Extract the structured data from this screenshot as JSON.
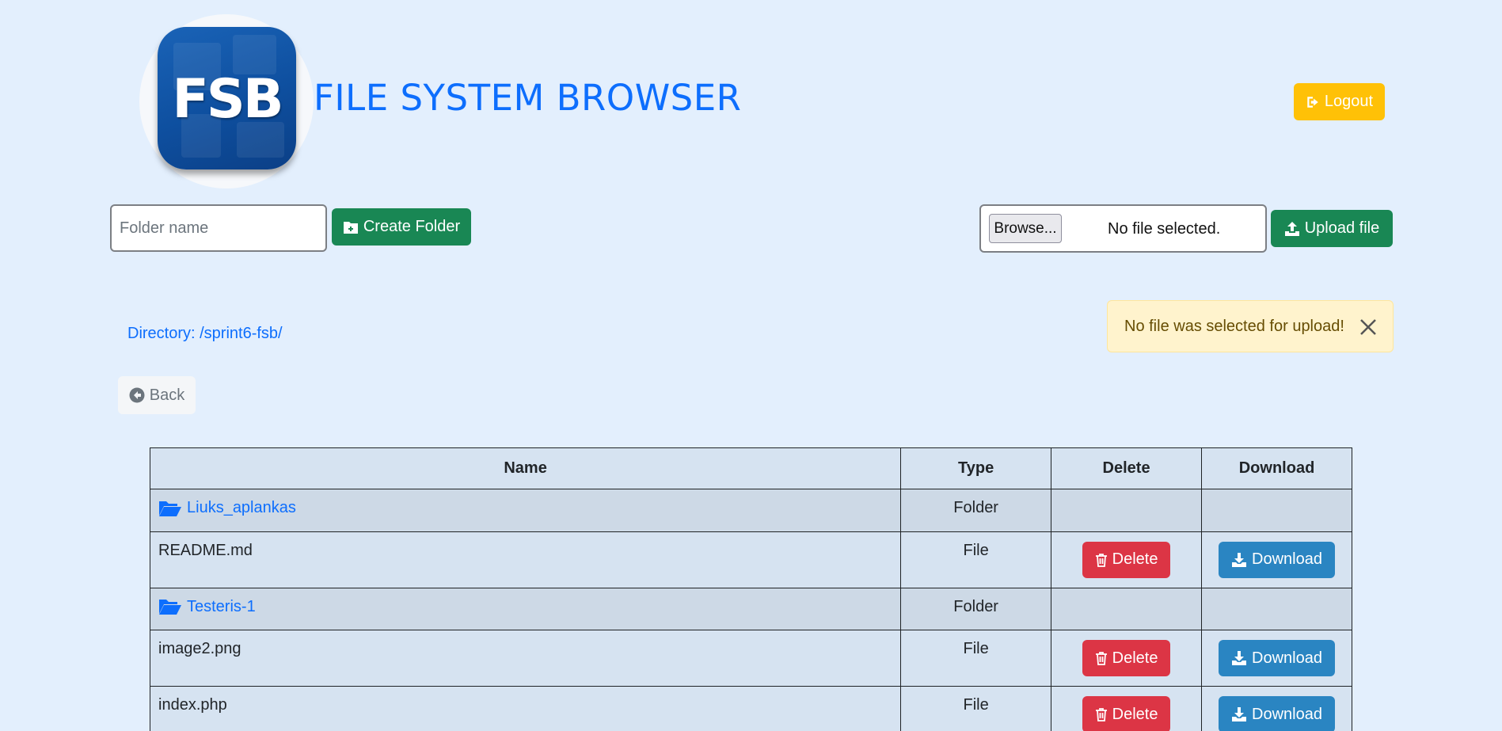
{
  "header": {
    "logo_text": "FSB",
    "title": "FILE SYSTEM BROWSER",
    "logout_label": "Logout"
  },
  "folder_form": {
    "placeholder": "Folder name",
    "value": "",
    "create_label": "Create Folder"
  },
  "upload_form": {
    "browse_label": "Browse...",
    "no_file_text": "No file selected.",
    "upload_label": "Upload file"
  },
  "alert": {
    "message": "No file was selected for upload!"
  },
  "directory": {
    "label": "Directory: /sprint6-fsb/"
  },
  "back_label": "Back",
  "table": {
    "headers": [
      "Name",
      "Type",
      "Delete",
      "Download"
    ],
    "rows": [
      {
        "name": "Liuks_aplankas",
        "type": "Folder"
      },
      {
        "name": "README.md",
        "type": "File",
        "delete": "Delete",
        "download": "Download"
      },
      {
        "name": "Testeris-1",
        "type": "Folder"
      },
      {
        "name": "image2.png",
        "type": "File",
        "delete": "Delete",
        "download": "Download"
      },
      {
        "name": "index.php",
        "type": "File",
        "delete": "Delete",
        "download": "Download"
      }
    ]
  },
  "colors": {
    "background": "#e3effd",
    "primary": "#0d6efd",
    "success": "#198754",
    "warning": "#ffc107",
    "danger": "#dc3545",
    "download": "#2a85c2",
    "alert_bg": "#fff3cd"
  },
  "icons": {
    "logout": "sign-out-icon",
    "create_folder": "folder-plus-icon",
    "upload": "upload-icon",
    "close": "close-icon",
    "back": "arrow-circle-left-icon",
    "folder": "folder-open-icon",
    "delete": "trash-icon",
    "download": "download-icon"
  }
}
